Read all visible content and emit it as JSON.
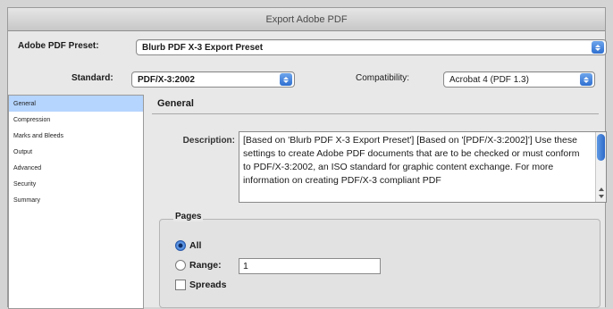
{
  "window": {
    "title": "Export Adobe PDF"
  },
  "preset": {
    "label": "Adobe PDF Preset:",
    "value": "Blurb PDF X-3 Export Preset"
  },
  "standard": {
    "label": "Standard:",
    "value": "PDF/X-3:2002"
  },
  "compatibility": {
    "label": "Compatibility:",
    "value": "Acrobat 4 (PDF 1.3)"
  },
  "sidebar": {
    "items": [
      {
        "label": "General"
      },
      {
        "label": "Compression"
      },
      {
        "label": "Marks and Bleeds"
      },
      {
        "label": "Output"
      },
      {
        "label": "Advanced"
      },
      {
        "label": "Security"
      },
      {
        "label": "Summary"
      }
    ]
  },
  "panel": {
    "title": "General"
  },
  "description": {
    "label": "Description:",
    "text": "[Based on 'Blurb PDF X-3 Export Preset'] [Based on '[PDF/X-3:2002]'] Use these settings to create Adobe PDF documents that are to be checked or must conform to PDF/X-3:2002, an ISO standard for graphic content exchange. For more information on creating PDF/X-3 compliant PDF"
  },
  "pages": {
    "group_label": "Pages",
    "all_label": "All",
    "range_label": "Range:",
    "range_value": "1",
    "spreads_label": "Spreads",
    "selected": "All"
  }
}
